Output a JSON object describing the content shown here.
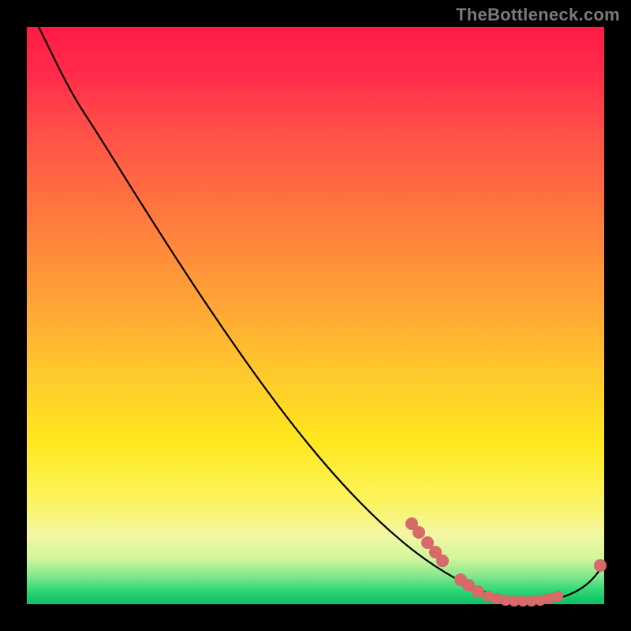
{
  "watermark": "TheBottleneck.com",
  "chart_data": {
    "type": "line",
    "title": "",
    "xlabel": "",
    "ylabel": "",
    "xlim": [
      0,
      100
    ],
    "ylim": [
      0,
      100
    ],
    "grid": false,
    "legend": false,
    "background_gradient": {
      "orientation": "vertical",
      "stops": [
        {
          "pos": 0.0,
          "color": "#ff1a45"
        },
        {
          "pos": 0.18,
          "color": "#ff4f48"
        },
        {
          "pos": 0.48,
          "color": "#ffa536"
        },
        {
          "pos": 0.72,
          "color": "#ffe81e"
        },
        {
          "pos": 0.92,
          "color": "#d3f59b"
        },
        {
          "pos": 0.98,
          "color": "#18c96c"
        },
        {
          "pos": 1.0,
          "color": "#0fbf63"
        }
      ]
    },
    "series": [
      {
        "name": "bottleneck-curve",
        "color": "#000000",
        "x": [
          2,
          5,
          10,
          15,
          22,
          30,
          40,
          55,
          69,
          77,
          83,
          88,
          92,
          95,
          98,
          100
        ],
        "y": [
          100,
          95,
          86,
          80,
          70,
          54,
          37,
          18,
          8,
          3,
          1,
          0.5,
          0.5,
          1.5,
          4,
          7
        ]
      }
    ],
    "markers": {
      "name": "highlighted-points",
      "color": "#d86a6a",
      "radius": 8,
      "points": [
        {
          "x": 67,
          "y": 14
        },
        {
          "x": 68,
          "y": 12.5
        },
        {
          "x": 69,
          "y": 10.7
        },
        {
          "x": 70.5,
          "y": 9
        },
        {
          "x": 72,
          "y": 7.5
        },
        {
          "x": 75,
          "y": 4.3
        },
        {
          "x": 76.5,
          "y": 3.3
        },
        {
          "x": 78,
          "y": 2.3
        },
        {
          "x": 80,
          "y": 1.4
        },
        {
          "x": 81.5,
          "y": 1
        },
        {
          "x": 83,
          "y": 0.7
        },
        {
          "x": 84.5,
          "y": 0.5
        },
        {
          "x": 86,
          "y": 0.5
        },
        {
          "x": 87.5,
          "y": 0.6
        },
        {
          "x": 89,
          "y": 0.7
        },
        {
          "x": 90.5,
          "y": 1
        },
        {
          "x": 92,
          "y": 1.3
        },
        {
          "x": 99,
          "y": 6.7
        }
      ]
    }
  }
}
